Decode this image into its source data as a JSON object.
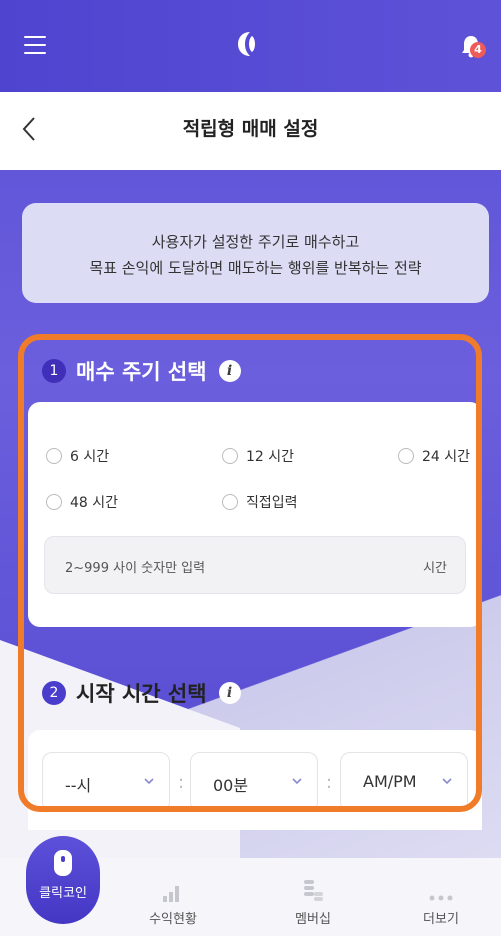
{
  "header": {
    "title": "적립형 매매 설정"
  },
  "notifications": {
    "count": "4"
  },
  "info": {
    "line1": "사용자가 설정한 주기로 매수하고",
    "line2": "목표 손익에 도달하면 매도하는 행위를 반복하는 전략"
  },
  "section1": {
    "number": "1",
    "title": "매수 주기 선택",
    "options": [
      "6 시간",
      "12 시간",
      "24 시간",
      "48 시간",
      "직접입력"
    ],
    "input_placeholder": "2~999 사이 숫자만 입력",
    "input_unit": "시간"
  },
  "section2": {
    "number": "2",
    "title": "시작 시간 선택",
    "hour": "--시",
    "minute": "00분",
    "ampm": "AM/PM",
    "separator": ":"
  },
  "info_icon_glyph": "i",
  "nav": {
    "click_coin": "클릭코인",
    "profit": "수익현황",
    "membership": "멤버십",
    "more": "더보기"
  },
  "colors": {
    "accent": "#5a4fd6",
    "highlight": "#f07c2a",
    "badge": "#ef5a5a"
  },
  "icons": [
    "menu-icon",
    "logo-icon",
    "bell-icon",
    "back-icon",
    "info-icon",
    "chevron-down-icon",
    "mouse-icon",
    "chart-icon",
    "coins-icon",
    "more-icon"
  ]
}
